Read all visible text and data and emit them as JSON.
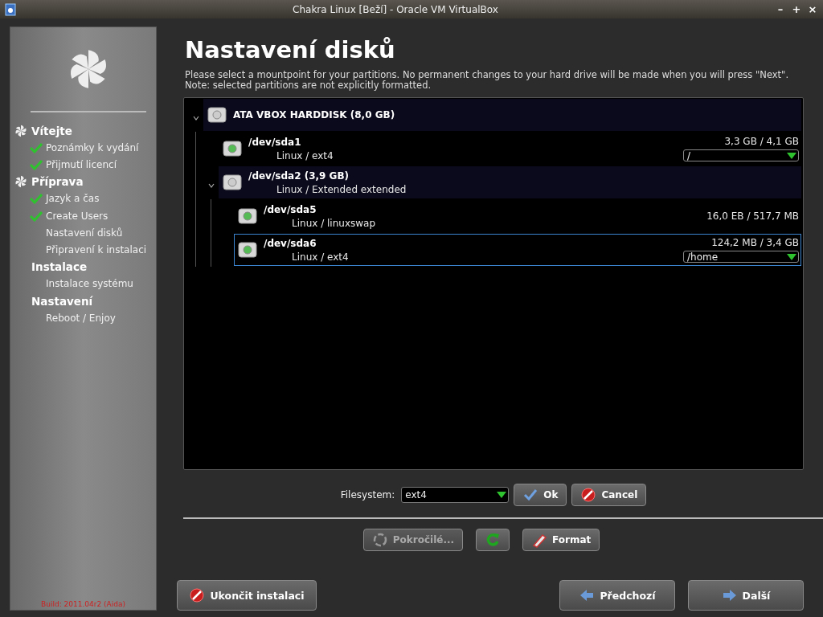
{
  "window": {
    "title": "Chakra Linux [Beží] - Oracle VM VirtualBox",
    "controls": [
      "–",
      "+",
      "×"
    ]
  },
  "sidebar": {
    "sections": [
      {
        "label": "Vítejte",
        "started": true,
        "items": [
          {
            "label": "Poznámky k vydání",
            "checked": true
          },
          {
            "label": "Přijmutí licencí",
            "checked": true
          }
        ]
      },
      {
        "label": "Příprava",
        "started": true,
        "items": [
          {
            "label": "Jazyk a čas",
            "checked": true
          },
          {
            "label": "Create Users",
            "checked": true
          },
          {
            "label": "Nastavení disků",
            "checked": false
          },
          {
            "label": "Připravení k instalaci",
            "checked": false
          }
        ]
      },
      {
        "label": "Instalace",
        "started": false,
        "items": [
          {
            "label": "Instalace systému",
            "checked": false
          }
        ]
      },
      {
        "label": "Nastavení",
        "started": false,
        "items": [
          {
            "label": "Reboot / Enjoy",
            "checked": false
          }
        ]
      }
    ],
    "build": "Build: 2011.04r2 (Aida)"
  },
  "page": {
    "title": "Nastavení disků",
    "description": "Please select a mountpoint for your partitions. No permanent changes to your hard drive will be made when you will press \"Next\". Note: selected partitions are not explicitly formatted."
  },
  "tree": [
    {
      "kind": "disk",
      "name": "ATA VBOX HARDDISK  (8,0 GB)",
      "expanded": true,
      "selected": false,
      "children": [
        {
          "kind": "partition",
          "name": "/dev/sda1",
          "subtitle": "Linux / ext4",
          "usage": "3,3 GB / 4,1 GB",
          "mountpoint": "/",
          "selected": false
        },
        {
          "kind": "extended",
          "name": "/dev/sda2  (3,9 GB)",
          "subtitle": "Linux / Extended extended",
          "expanded": true,
          "selected": false,
          "children": [
            {
              "kind": "partition",
              "name": "/dev/sda5",
              "subtitle": "Linux / linuxswap",
              "usage": "16,0 EB / 517,7 MB",
              "selected": false
            },
            {
              "kind": "partition",
              "name": "/dev/sda6",
              "subtitle": "Linux / ext4",
              "usage": "124,2 MB / 3,4 GB",
              "mountpoint": "/home",
              "selected": true
            }
          ]
        }
      ]
    }
  ],
  "filesystem": {
    "label": "Filesystem:",
    "value": "ext4",
    "buttons": [
      {
        "kind": "ok",
        "label": "Ok"
      },
      {
        "kind": "cancel",
        "label": "Cancel"
      }
    ]
  },
  "tools": [
    {
      "kind": "advanced",
      "label": "Pokročilé...",
      "disabled": true
    },
    {
      "kind": "refresh",
      "disabled": false
    },
    {
      "kind": "format",
      "label": "Format",
      "disabled": false
    }
  ],
  "footer": {
    "quit": "Ukončit instalaci",
    "back": "Předchozí",
    "next": "Další"
  }
}
